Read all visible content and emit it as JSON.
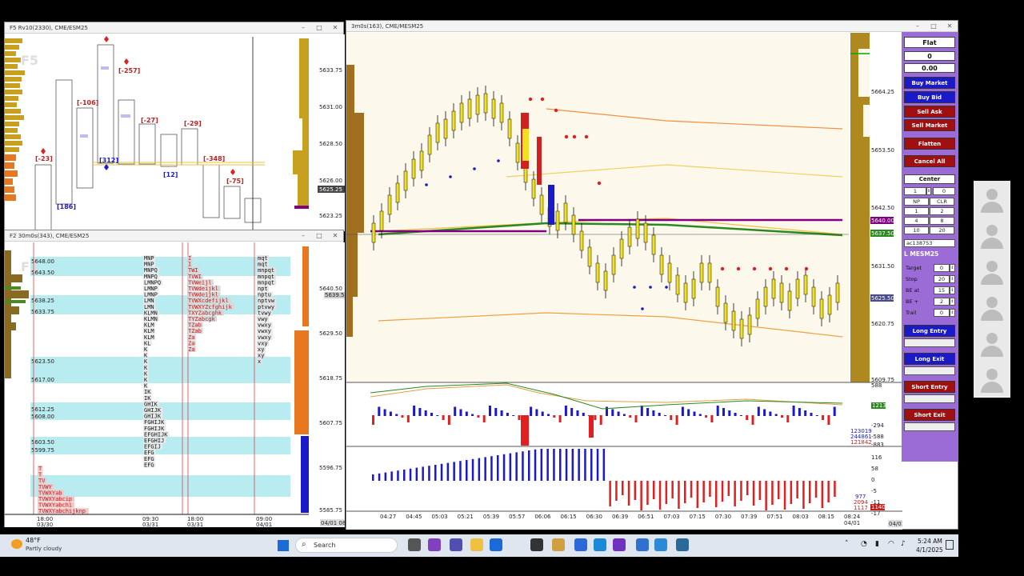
{
  "window_top_left": {
    "title": "F5 Rv10(2330), CME/ESM25",
    "watermark": "F5",
    "price_labels": [
      "5633.75",
      "5631.00",
      "5628.50",
      "5626.00",
      "5625.25",
      "5623.25"
    ],
    "annotations": [
      "[-23]",
      "[-106]",
      "[-257]",
      "[-27]",
      "[-29]",
      "[-348]",
      "[-75]",
      "[186]",
      "[312]",
      "[12]"
    ]
  },
  "window_bottom_left": {
    "title": "F2 30m0s(343), CME/ESM25",
    "watermark": "F2",
    "level_labels": [
      "5648.00",
      "5643.50",
      "5638.25",
      "5633.75",
      "5623.50",
      "5617.00",
      "5612.25",
      "5608.00",
      "5603.50",
      "5599.75"
    ],
    "price_labels": [
      "5640.50",
      "5639.50",
      "5629.50",
      "5618.75",
      "5607.75",
      "5596.75",
      "5585.75"
    ],
    "time_labels": [
      "18:00\n03/30",
      "09:30\n03/31",
      "18:00\n03/31",
      "09:00\n04/01"
    ],
    "date_label": "04/01 08:00",
    "tpo_col1": [
      "MNP",
      "MNP",
      "MNPQ",
      "MNPQ",
      "LMNPQ",
      "LMNP",
      "LMNP",
      "LMN",
      "LMN",
      "KLMN",
      "KLMN",
      "KLM",
      "KLM",
      "KLM",
      "KL",
      "K",
      "K",
      "K",
      "K",
      "K",
      "K",
      "K",
      "IK",
      "IK",
      "GHIK",
      "GHIJK",
      "GHIJK",
      "FGHIJK",
      "FGHIJK",
      "EFGHIJK",
      "EFGHIJ",
      "EFGIJ",
      "EFG",
      "EFG",
      "EFG"
    ],
    "tpo_col2": [
      "I",
      "I",
      "TWI",
      "TVWI",
      "TVWeijl",
      "TVWdeijkl",
      "TVWdeijkl",
      "TVWXcdefijkl",
      "TVWXYZcfghijk",
      "TXYZabcghk",
      "TYZabcgk",
      "TZab",
      "TZab",
      "Za",
      "Za",
      "Za"
    ],
    "tpo_col3": [
      "mqt",
      "mqt",
      "mnpqt",
      "mnpqt",
      "mnpqt",
      "npt",
      "nptu",
      "nptvw",
      "ptvwy",
      "tvwy",
      "vwy",
      "vwxy",
      "vwxy",
      "vwxy",
      "vxy",
      "xy",
      "xy",
      "x"
    ],
    "tpo_col0": [
      "T",
      "T",
      "TV",
      "TVWY",
      "TVWXYab",
      "TVWXYabcip",
      "TVWXYabchi",
      "TVWXYabchijknp"
    ]
  },
  "window_main": {
    "title": "3m0s(163), CME/MESM25",
    "price_labels": [
      "5664.25",
      "5653.50",
      "5642.50",
      "5640.00",
      "5637.50",
      "5631.50",
      "5625.50",
      "5620.75",
      "5609.75"
    ],
    "time_labels": [
      "04:27",
      "04:45",
      "05:03",
      "05:21",
      "05:39",
      "05:57",
      "06:06",
      "06:15",
      "06:30",
      "06:39",
      "06:51",
      "07:03",
      "07:15",
      "07:30",
      "07:39",
      "07:51",
      "08:03",
      "08:15",
      "08:24\n04/01"
    ],
    "date_label": "04/01 08:24",
    "ind1_labels": [
      "588",
      "-294",
      "-588",
      "-883"
    ],
    "ind1_values": [
      "1213",
      "123019",
      "244861",
      "121842"
    ],
    "ind2_labels": [
      "116",
      "58",
      "0",
      "-5",
      "-11",
      "-17"
    ],
    "ind2_values": [
      "977",
      "2094",
      "1117",
      "1140"
    ]
  },
  "order_panel": {
    "position": "Flat",
    "qty": "0",
    "pnl": "0.00",
    "buy_market": "Buy Market",
    "buy_bid": "Buy Bid",
    "sell_ask": "Sell Ask",
    "sell_market": "Sell Market",
    "flatten": "Flatten",
    "cancel_all": "Cancel All",
    "center": "Center",
    "qty_input": "1",
    "qty_right": "0",
    "grid": [
      [
        "NP",
        "CLR"
      ],
      [
        "1",
        "2"
      ],
      [
        "4",
        "8"
      ],
      [
        "10",
        "20"
      ]
    ],
    "account": "ac138753",
    "symbol": "L MESM25",
    "fields": [
      {
        "label": "Target",
        "value": "0"
      },
      {
        "label": "Stop",
        "value": "20"
      },
      {
        "label": "BE at",
        "value": "15"
      },
      {
        "label": "BE +",
        "value": "2"
      },
      {
        "label": "Trail",
        "value": "0"
      }
    ],
    "long_entry": "Long Entry",
    "long_exit": "Long Exit",
    "short_entry": "Short Entry",
    "short_exit": "Short Exit"
  },
  "taskbar": {
    "weather_temp": "48°F",
    "weather_desc": "Partly cloudy",
    "search_placeholder": "Search",
    "time": "5:24 AM",
    "date": "4/1/2025"
  },
  "colors": {
    "buy": "#1a1ac8",
    "sell": "#a01010",
    "panel": "#9b6bd6",
    "chart_bg": "#fdf8ec",
    "level_band": "#b8ecf0"
  }
}
